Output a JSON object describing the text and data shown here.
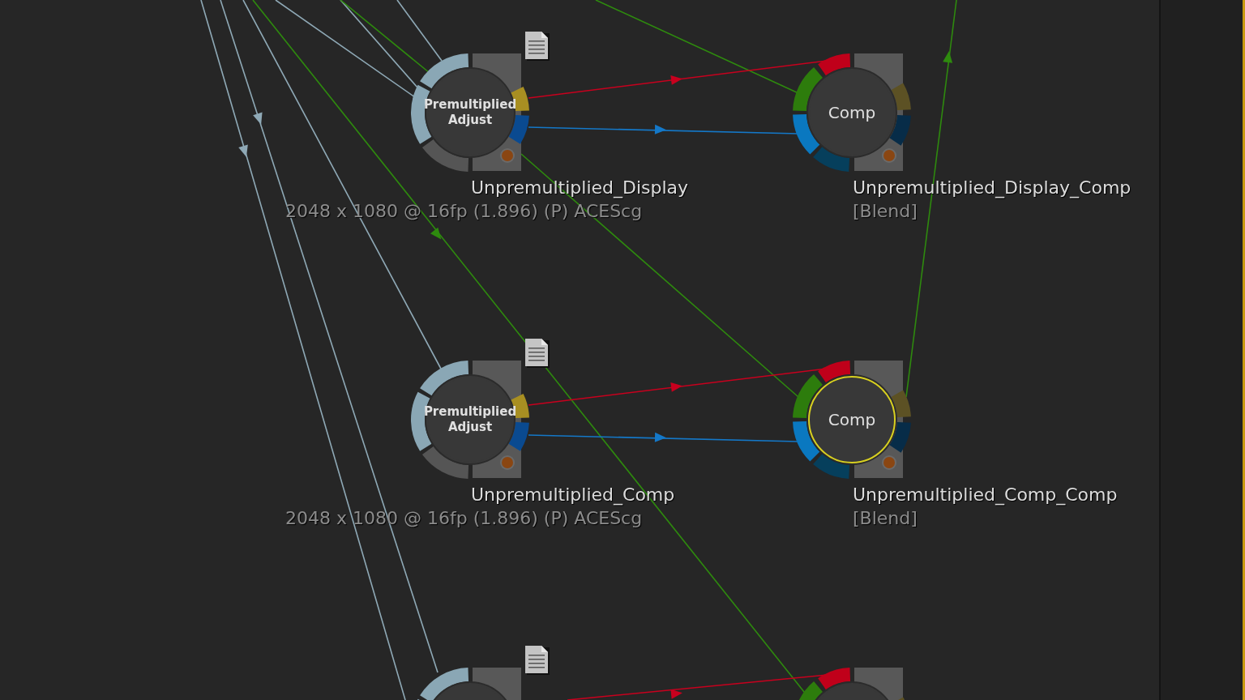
{
  "nodes": [
    {
      "kind": "adjust",
      "label": "Premultiplied Adjust",
      "name": "Unpremultiplied_Display",
      "info": "2048 x 1080 @ 16fp (1.896) (P) ACEScg",
      "selected": false
    },
    {
      "kind": "comp",
      "label": "Comp",
      "name": "Unpremultiplied_Display_Comp",
      "info": "[Blend]",
      "selected": false
    },
    {
      "kind": "adjust",
      "label": "Premultiplied Adjust",
      "name": "Unpremultiplied_Comp",
      "info": "2048 x 1080 @ 16fp (1.896) (P) ACEScg",
      "selected": false
    },
    {
      "kind": "comp",
      "label": "Comp",
      "name": "Unpremultiplied_Comp_Comp",
      "info": "[Blend]",
      "selected": true
    },
    {
      "kind": "adjust",
      "selected": false
    },
    {
      "kind": "comp",
      "selected": false
    }
  ]
}
